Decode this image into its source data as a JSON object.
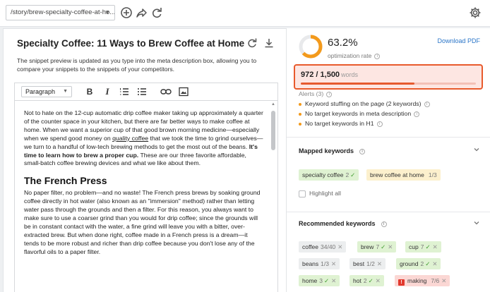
{
  "topbar": {
    "url": "/story/brew-specialty-coffee-at-ho...",
    "icons": [
      "add-icon",
      "share-icon",
      "refresh-icon",
      "settings-icon"
    ]
  },
  "editor": {
    "title": "Specialty Coffee: 11 Ways to Brew Coffee at Home",
    "description": "The snippet preview is updated as you type into the meta description box, allowing you to compare your snippets to the snippets of your competitors.",
    "paragraph_style": "Paragraph",
    "toolbar_icons": [
      "bold-icon",
      "italic-icon",
      "ordered-list-icon",
      "bullet-list-icon",
      "link-icon",
      "image-icon"
    ],
    "body": {
      "p1_a": "Not to hate on the 12-cup automatic drip coffee maker taking up approximately a quarter of the counter space in your kitchen, but there are far better ways to make coffee at home. When we want a superior cup of that good brown morning medicine—especially when we spend good money on ",
      "p1_link": "quality coffee",
      "p1_b": " that we took the time to grind ourselves—we turn to a handful of low-tech brewing methods to get the most out of the beans. ",
      "p1_bold": "It's time to learn how to brew a proper cup.",
      "p1_c": " These are our three favorite affordable, small-batch coffee brewing devices and what we like about them.",
      "heading": "The French Press",
      "p2": "No paper filter, no problem—and no waste! The French press brews by soaking ground coffee directly in hot water (also known as an \"immersion\" method) rather than letting water pass through the grounds and then a filter. For this reason, you always want to make sure to use a coarser grind than you would for drip coffee; since the grounds will be in constant contact with the water, a fine grind will leave you with a bitter, over-extracted brew. But when done right, coffee made in a French press is a dream—it tends to be more robust and richer than drip coffee because you don't lose any of the flavorful oils to a paper filter."
    }
  },
  "score": {
    "percent_label": "63.2%",
    "percent_value": 63.2,
    "label": "optimization rate",
    "download": "Download PDF",
    "ring_color": "#f39a1c"
  },
  "words": {
    "count": "972 / 1,500",
    "label": "words",
    "progress": 0.648
  },
  "alerts": {
    "header": "Alerts (3)",
    "items": [
      "Keyword stuffing on the page (2 keywords)",
      "No target keywords in meta description",
      "No target keywords in H1"
    ]
  },
  "mapped": {
    "title": "Mapped keywords",
    "keywords": [
      {
        "text": "specialty coffee",
        "count": "2",
        "status": "green"
      },
      {
        "text": "brew coffee at home",
        "count": "1/3",
        "status": "yellow"
      }
    ],
    "highlight_all": "Highlight all"
  },
  "recommended": {
    "title": "Recommended keywords",
    "keywords": [
      {
        "text": "coffee",
        "count": "34/40",
        "status": "gray"
      },
      {
        "text": "brew",
        "count": "7",
        "status": "green"
      },
      {
        "text": "cup",
        "count": "7",
        "status": "green"
      },
      {
        "text": "beans",
        "count": "1/3",
        "status": "gray"
      },
      {
        "text": "best",
        "count": "1/2",
        "status": "gray"
      },
      {
        "text": "ground",
        "count": "2",
        "status": "green"
      },
      {
        "text": "home",
        "count": "3",
        "status": "green"
      },
      {
        "text": "hot",
        "count": "2",
        "status": "green"
      },
      {
        "text": "making",
        "count": "7/6",
        "status": "red"
      }
    ]
  }
}
